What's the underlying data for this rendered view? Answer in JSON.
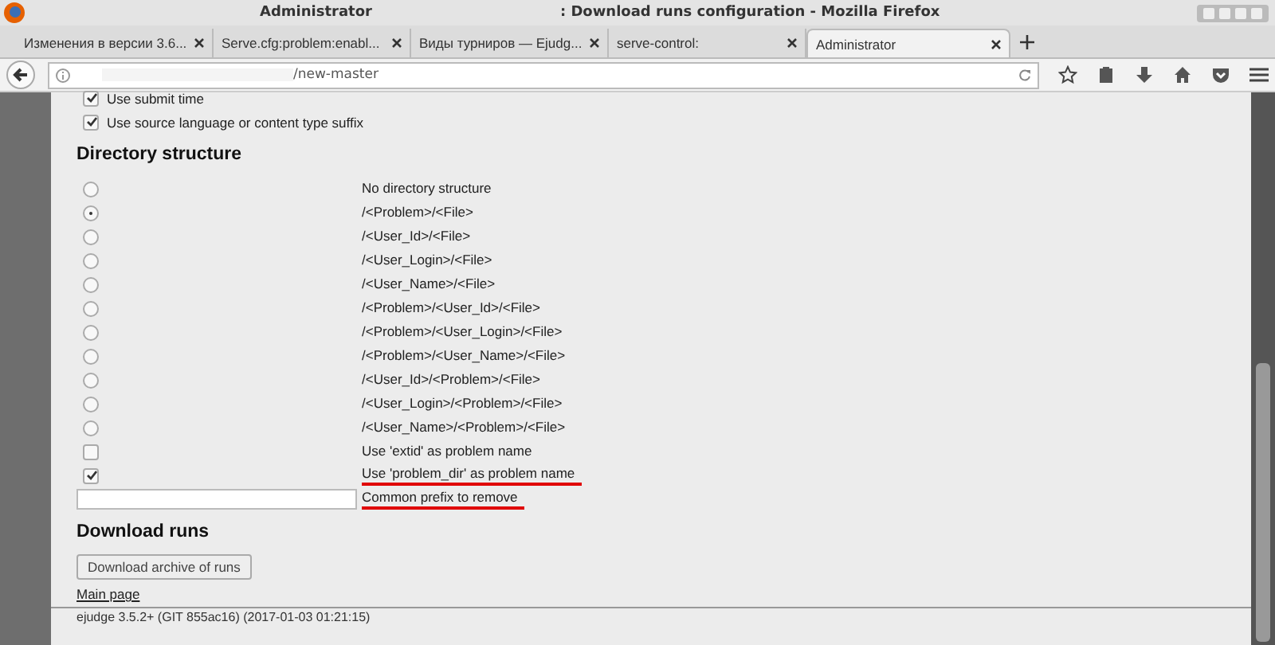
{
  "window": {
    "title_left": "Administrator",
    "title_right": ": Download runs configuration - Mozilla Firefox"
  },
  "tabs": [
    {
      "label": "Изменения в версии 3.6...",
      "selected": false
    },
    {
      "label": "Serve.cfg:problem:enabl...",
      "selected": false
    },
    {
      "label": "Виды турниров — Ejudg...",
      "selected": false
    },
    {
      "label": "serve-control:",
      "selected": false
    },
    {
      "label": "Administrator",
      "selected": true
    }
  ],
  "address_bar": {
    "url": "/new-master"
  },
  "options_top": [
    {
      "label": "Use submit time",
      "checked": true
    },
    {
      "label": "Use source language or content type suffix",
      "checked": true
    }
  ],
  "directory_section": {
    "heading": "Directory structure",
    "rows": [
      {
        "kind": "radio",
        "label": "No directory structure",
        "selected": false,
        "underlined": false
      },
      {
        "kind": "radio",
        "label": "/<Problem>/<File>",
        "selected": true,
        "underlined": false
      },
      {
        "kind": "radio",
        "label": "/<User_Id>/<File>",
        "selected": false,
        "underlined": false
      },
      {
        "kind": "radio",
        "label": "/<User_Login>/<File>",
        "selected": false,
        "underlined": false
      },
      {
        "kind": "radio",
        "label": "/<User_Name>/<File>",
        "selected": false,
        "underlined": false
      },
      {
        "kind": "radio",
        "label": "/<Problem>/<User_Id>/<File>",
        "selected": false,
        "underlined": false
      },
      {
        "kind": "radio",
        "label": "/<Problem>/<User_Login>/<File>",
        "selected": false,
        "underlined": false
      },
      {
        "kind": "radio",
        "label": "/<Problem>/<User_Name>/<File>",
        "selected": false,
        "underlined": false
      },
      {
        "kind": "radio",
        "label": "/<User_Id>/<Problem>/<File>",
        "selected": false,
        "underlined": false
      },
      {
        "kind": "radio",
        "label": "/<User_Login>/<Problem>/<File>",
        "selected": false,
        "underlined": false
      },
      {
        "kind": "radio",
        "label": "/<User_Name>/<Problem>/<File>",
        "selected": false,
        "underlined": false
      },
      {
        "kind": "checkbox",
        "label": "Use 'extid' as problem name",
        "checked": false,
        "underlined": false
      },
      {
        "kind": "checkbox",
        "label": "Use 'problem_dir' as problem name",
        "checked": true,
        "underlined": true
      },
      {
        "kind": "input",
        "label": "Common prefix to remove",
        "underlined": true
      }
    ]
  },
  "download_section": {
    "heading": "Download runs",
    "button": "Download archive of runs",
    "link": "Main page"
  },
  "footer": "ejudge 3.5.2+ (GIT 855ac16) (2017-01-03 01:21:15)"
}
